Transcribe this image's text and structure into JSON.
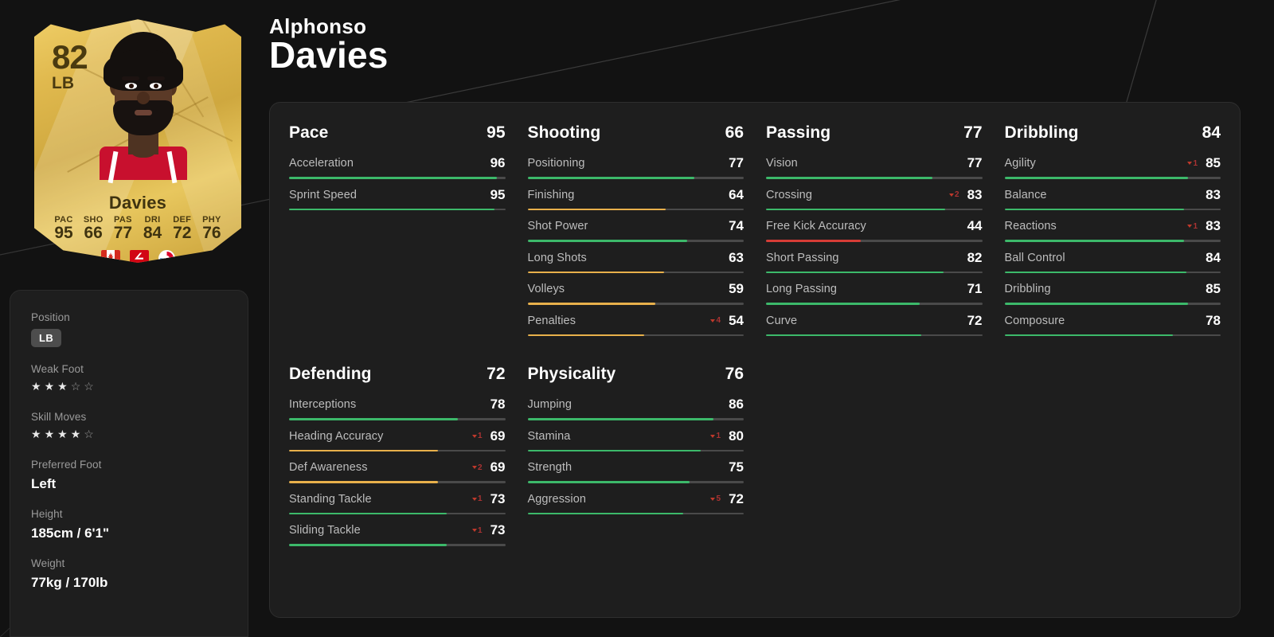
{
  "player": {
    "first_name": "Alphonso",
    "last_name": "Davies",
    "card": {
      "rating": "82",
      "position": "LB",
      "name": "Davies",
      "stats": [
        {
          "label": "PAC",
          "value": "95"
        },
        {
          "label": "SHO",
          "value": "66"
        },
        {
          "label": "PAS",
          "value": "77"
        },
        {
          "label": "DRI",
          "value": "84"
        },
        {
          "label": "DEF",
          "value": "72"
        },
        {
          "label": "PHY",
          "value": "76"
        }
      ],
      "badges": [
        "canada-flag",
        "bundesliga-logo",
        "bayern-munich-crest"
      ]
    }
  },
  "info": {
    "position_label": "Position",
    "position_value": "LB",
    "weak_foot_label": "Weak Foot",
    "weak_foot": 3,
    "skill_moves_label": "Skill Moves",
    "skill_moves": 4,
    "preferred_foot_label": "Preferred Foot",
    "preferred_foot_value": "Left",
    "height_label": "Height",
    "height_value": "185cm / 6'1\"",
    "weight_label": "Weight",
    "weight_value": "77kg / 170lb",
    "star_total": 5
  },
  "colors": {
    "high": "#3cb96a",
    "mid": "#e8b04b",
    "low": "#d63c36",
    "track": "#4a4a4a",
    "panel": "#1e1e1e",
    "page": "#121212",
    "modifier": "#c0392b"
  },
  "chart_data": {
    "type": "bar",
    "title": "Alphonso Davies Player Attributes",
    "ylim": [
      0,
      100
    ],
    "groups": [
      {
        "name": "Pace",
        "total": 95,
        "stats": [
          {
            "name": "Acceleration",
            "value": 96,
            "color": "high",
            "modifier": null
          },
          {
            "name": "Sprint Speed",
            "value": 95,
            "color": "high",
            "modifier": null
          }
        ]
      },
      {
        "name": "Shooting",
        "total": 66,
        "stats": [
          {
            "name": "Positioning",
            "value": 77,
            "color": "high",
            "modifier": null
          },
          {
            "name": "Finishing",
            "value": 64,
            "color": "mid",
            "modifier": null
          },
          {
            "name": "Shot Power",
            "value": 74,
            "color": "high",
            "modifier": null
          },
          {
            "name": "Long Shots",
            "value": 63,
            "color": "mid",
            "modifier": null
          },
          {
            "name": "Volleys",
            "value": 59,
            "color": "mid",
            "modifier": null
          },
          {
            "name": "Penalties",
            "value": 54,
            "color": "mid",
            "modifier": "4"
          }
        ]
      },
      {
        "name": "Passing",
        "total": 77,
        "stats": [
          {
            "name": "Vision",
            "value": 77,
            "color": "high",
            "modifier": null
          },
          {
            "name": "Crossing",
            "value": 83,
            "color": "high",
            "modifier": "2"
          },
          {
            "name": "Free Kick Accuracy",
            "value": 44,
            "color": "low",
            "modifier": null
          },
          {
            "name": "Short Passing",
            "value": 82,
            "color": "high",
            "modifier": null
          },
          {
            "name": "Long Passing",
            "value": 71,
            "color": "high",
            "modifier": null
          },
          {
            "name": "Curve",
            "value": 72,
            "color": "high",
            "modifier": null
          }
        ]
      },
      {
        "name": "Dribbling",
        "total": 84,
        "stats": [
          {
            "name": "Agility",
            "value": 85,
            "color": "high",
            "modifier": "1"
          },
          {
            "name": "Balance",
            "value": 83,
            "color": "high",
            "modifier": null
          },
          {
            "name": "Reactions",
            "value": 83,
            "color": "high",
            "modifier": "1"
          },
          {
            "name": "Ball Control",
            "value": 84,
            "color": "high",
            "modifier": null
          },
          {
            "name": "Dribbling",
            "value": 85,
            "color": "high",
            "modifier": null
          },
          {
            "name": "Composure",
            "value": 78,
            "color": "high",
            "modifier": null
          }
        ]
      },
      {
        "name": "Defending",
        "total": 72,
        "stats": [
          {
            "name": "Interceptions",
            "value": 78,
            "color": "high",
            "modifier": null
          },
          {
            "name": "Heading Accuracy",
            "value": 69,
            "color": "mid",
            "modifier": "1"
          },
          {
            "name": "Def Awareness",
            "value": 69,
            "color": "mid",
            "modifier": "2"
          },
          {
            "name": "Standing Tackle",
            "value": 73,
            "color": "high",
            "modifier": "1"
          },
          {
            "name": "Sliding Tackle",
            "value": 73,
            "color": "high",
            "modifier": "1"
          }
        ]
      },
      {
        "name": "Physicality",
        "total": 76,
        "stats": [
          {
            "name": "Jumping",
            "value": 86,
            "color": "high",
            "modifier": null
          },
          {
            "name": "Stamina",
            "value": 80,
            "color": "high",
            "modifier": "1"
          },
          {
            "name": "Strength",
            "value": 75,
            "color": "high",
            "modifier": null
          },
          {
            "name": "Aggression",
            "value": 72,
            "color": "high",
            "modifier": "5"
          }
        ]
      }
    ]
  }
}
